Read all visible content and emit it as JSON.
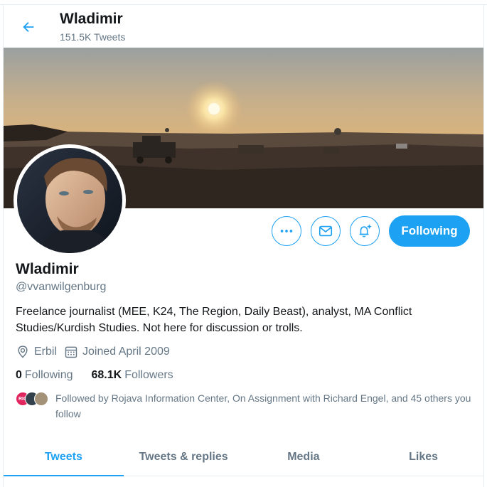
{
  "header": {
    "title": "Wladimir",
    "tweet_count": "151.5K Tweets"
  },
  "profile": {
    "name": "Wladimir",
    "handle": "@vvanwilgenburg",
    "bio": "Freelance journalist (MEE, K24, The Region, Daily Beast), analyst, MA Conflict Studies/Kurdish Studies. Not here for discussion or trolls.",
    "location": "Erbil",
    "joined": "Joined April 2009",
    "following_count": "0",
    "following_label": "Following",
    "followers_count": "68.1K",
    "followers_label": "Followers",
    "followed_by": "Followed by Rojava Information Center, On Assignment with Richard Engel, and 45 others you follow",
    "followed_by_avatar_badge": "RIC"
  },
  "actions": {
    "follow_label": "Following",
    "more_icon": "more-icon",
    "message_icon": "envelope-icon",
    "notify_icon": "bell-plus-icon"
  },
  "tabs": [
    {
      "label": "Tweets",
      "active": true
    },
    {
      "label": "Tweets & replies",
      "active": false
    },
    {
      "label": "Media",
      "active": false
    },
    {
      "label": "Likes",
      "active": false
    }
  ],
  "colors": {
    "accent": "#1da1f2",
    "secondary_text": "#657786",
    "primary_text": "#14171a"
  }
}
